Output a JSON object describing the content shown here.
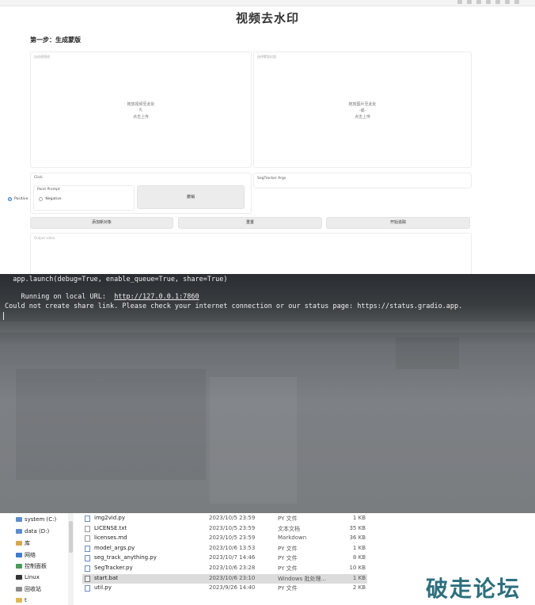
{
  "gradio": {
    "title": "视频去水印",
    "step_heading": "第一步：生成蒙版",
    "input_video": {
      "label": "自动视频帧",
      "drop_text": "拖放视频至此处",
      "or_text": "-或-",
      "upload_text": "点击上传"
    },
    "input_image": {
      "label": "选择蒙版封面",
      "drop_text": "拖放图片至此处",
      "or_text": "-或-",
      "upload_text": "点击上传"
    },
    "click_panel": {
      "label": "Click",
      "point_prompt_label": "Point Prompt",
      "positive": "Positive",
      "negative": "Negative",
      "undo_button": "撤销"
    },
    "segtracker_label": "SegTracker Args",
    "buttons": {
      "add_object": "添加新对象",
      "reset": "重置",
      "start_track": "开始追踪"
    },
    "output_label": "Output video"
  },
  "terminal": {
    "line1": "  app.launch(debug=True, enable_queue=True, share=True)",
    "running_prefix": "Running on local URL:  ",
    "running_url": "http://127.0.0.1:7860",
    "error_line": "Could not create share link. Please check your internet connection or our status page: https://status.gradio.app."
  },
  "explorer": {
    "nav": [
      {
        "label": "system (C:)",
        "icon": "drive-icon",
        "color": "#5b8ccf"
      },
      {
        "label": "data (D:)",
        "icon": "drive-icon",
        "color": "#5b8ccf"
      },
      {
        "label": "库",
        "icon": "library-icon",
        "color": "#d4a94b"
      },
      {
        "label": "网络",
        "icon": "network-icon",
        "color": "#3d7bd0"
      },
      {
        "label": "控制面板",
        "icon": "control-panel-icon",
        "color": "#4a9a5a"
      },
      {
        "label": "Linux",
        "icon": "linux-icon",
        "color": "#333333"
      },
      {
        "label": "回收站",
        "icon": "recycle-bin-icon",
        "color": "#8a8a8a"
      },
      {
        "label": "t",
        "icon": "folder-icon",
        "color": "#e0b84f"
      }
    ],
    "files": [
      {
        "name": "img2vid.py",
        "date": "2023/10/5 23:59",
        "type": "PY 文件",
        "size": "1 KB",
        "kind": "py"
      },
      {
        "name": "LICENSE.txt",
        "date": "2023/10/5 23:59",
        "type": "文本文档",
        "size": "35 KB",
        "kind": "txt"
      },
      {
        "name": "licenses.md",
        "date": "2023/10/5 23:59",
        "type": "Markdown",
        "size": "36 KB",
        "kind": "md"
      },
      {
        "name": "model_args.py",
        "date": "2023/10/6 13:53",
        "type": "PY 文件",
        "size": "1 KB",
        "kind": "py"
      },
      {
        "name": "seg_track_anything.py",
        "date": "2023/10/7 14:46",
        "type": "PY 文件",
        "size": "8 KB",
        "kind": "py"
      },
      {
        "name": "SegTracker.py",
        "date": "2023/10/6 23:28",
        "type": "PY 文件",
        "size": "10 KB",
        "kind": "py"
      },
      {
        "name": "start.bat",
        "date": "2023/10/6 23:10",
        "type": "Windows 批处理...",
        "size": "1 KB",
        "kind": "bat",
        "selected": true
      },
      {
        "name": "util.py",
        "date": "2023/9/26 14:40",
        "type": "PY 文件",
        "size": "2 KB",
        "kind": "py"
      }
    ]
  },
  "watermark": "破走论坛"
}
